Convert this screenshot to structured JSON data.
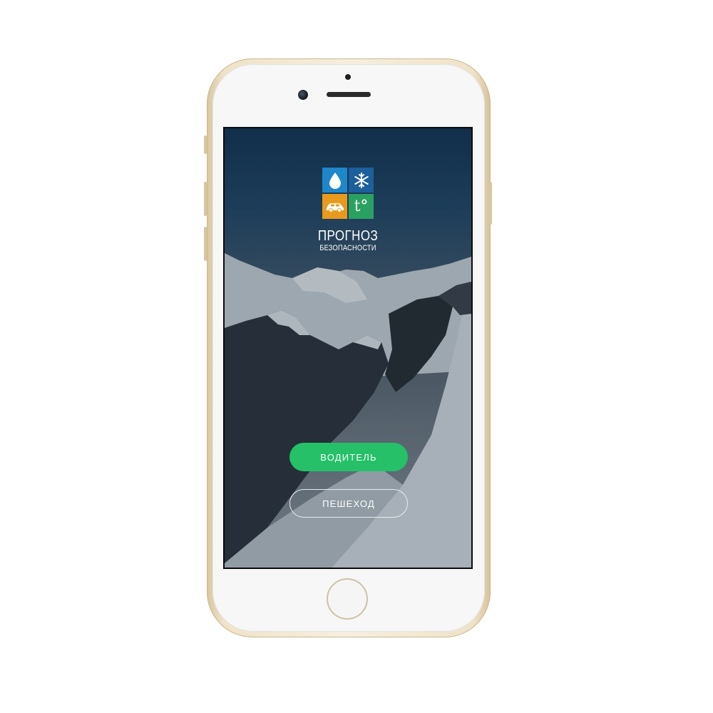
{
  "app": {
    "brand_title": "ПРОГНОЗ",
    "brand_subtitle": "БЕЗОПАСНОСТИ"
  },
  "logo": {
    "tiles": [
      {
        "icon": "water-drop-icon",
        "color": "#1f86c9"
      },
      {
        "icon": "snowflake-icon",
        "color": "#1c5f9a"
      },
      {
        "icon": "car-icon",
        "color": "#e79a1e"
      },
      {
        "icon": "temperature-icon",
        "color": "#2aa061",
        "label": "t°"
      }
    ]
  },
  "buttons": {
    "driver_label": "ВОДИТЕЛЬ",
    "pedestrian_label": "ПЕШЕХОД"
  },
  "colors": {
    "primary_green": "#25c068",
    "sky_top": "#0e2f4f",
    "phone_frame": "#efe3c8"
  }
}
